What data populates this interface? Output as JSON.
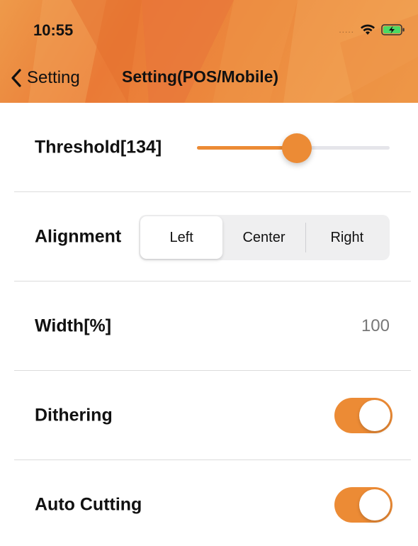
{
  "status_bar": {
    "time": "10:55",
    "signal": "....."
  },
  "nav": {
    "back_label": "Setting",
    "title": "Setting(POS/Mobile)"
  },
  "colors": {
    "accent": "#ec8b35",
    "header": "#ea7a36"
  },
  "settings": {
    "threshold": {
      "label": "Threshold[134]",
      "slider_fraction": 0.52
    },
    "alignment": {
      "label": "Alignment",
      "options": [
        "Left",
        "Center",
        "Right"
      ],
      "selected": "Left"
    },
    "width": {
      "label": "Width[%]",
      "value": "100"
    },
    "dithering": {
      "label": "Dithering",
      "enabled": true
    },
    "auto_cutting": {
      "label": "Auto Cutting",
      "enabled": true
    }
  },
  "icons": {
    "back": "chevron-left-icon",
    "wifi": "wifi-icon",
    "battery": "battery-charging-icon"
  }
}
